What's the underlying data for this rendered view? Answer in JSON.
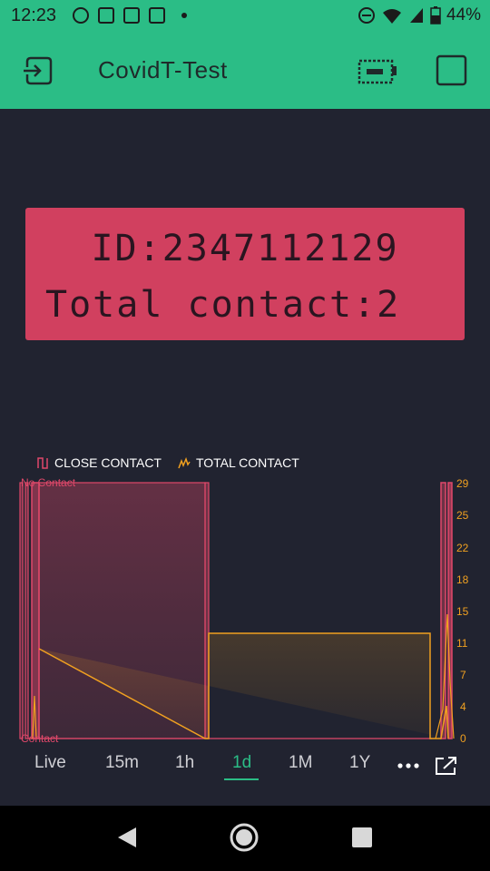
{
  "status_bar": {
    "time": "12:23",
    "battery": "44%",
    "icons_left": [
      "messenger-icon",
      "app-icon",
      "app-icon",
      "app-icon",
      "dot-icon"
    ],
    "icons_right": [
      "dnd-icon",
      "wifi-icon",
      "signal-icon",
      "battery-icon"
    ]
  },
  "app_bar": {
    "title": "CovidT-Test",
    "color": "#2bbd86"
  },
  "lcd": {
    "line1": "ID:2347112129",
    "line2": "Total contact:2",
    "background": "#d1405f"
  },
  "chart_data": {
    "type": "area",
    "series": [
      {
        "name": "CLOSE CONTACT",
        "color": "#e0486a"
      },
      {
        "name": "TOTAL CONTACT",
        "color": "#f0a020"
      }
    ],
    "left_axis_labels": [
      "No Contact",
      "Contact"
    ],
    "right_axis_ticks": [
      "29",
      "25",
      "22",
      "18",
      "15",
      "11",
      "7",
      "4",
      "0"
    ],
    "ylim_right": [
      0,
      29
    ]
  },
  "ranges": {
    "items": [
      "Live",
      "15m",
      "1h",
      "1d",
      "1M",
      "1Y"
    ],
    "active": "1d"
  }
}
